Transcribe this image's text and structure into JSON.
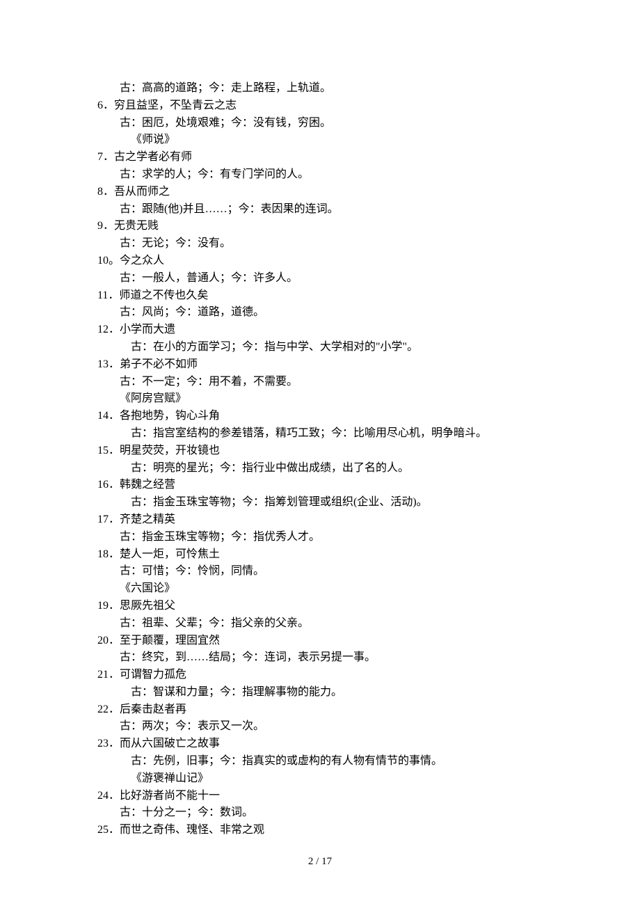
{
  "lines": [
    {
      "indent": 1,
      "text": "古：高高的道路；今：走上路程，上轨道。"
    },
    {
      "indent": 0,
      "text": "6．穷且益坚，不坠青云之志"
    },
    {
      "indent": 1,
      "text": "古：困厄，处境艰难；今：没有钱，穷困。"
    },
    {
      "indent": 2,
      "text": "《师说》"
    },
    {
      "indent": 0,
      "text": "7．古之学者必有师"
    },
    {
      "indent": 1,
      "text": "古：求学的人；今：有专门学问的人。"
    },
    {
      "indent": 0,
      "text": "8．吾从而师之"
    },
    {
      "indent": 1,
      "text": "古：跟随(他)并且……；今：表因果的连词。"
    },
    {
      "indent": 0,
      "text": "9．无贵无贱"
    },
    {
      "indent": 1,
      "text": "古：无论；今：没有。"
    },
    {
      "indent": 0,
      "text": "10。今之众人"
    },
    {
      "indent": 1,
      "text": "古：一般人，普通人；今：许多人。"
    },
    {
      "indent": 0,
      "text": "11．师道之不传也久矣"
    },
    {
      "indent": 1,
      "text": "古：风尚；今：道路，道德。"
    },
    {
      "indent": 0,
      "text": "12．小学而大遗"
    },
    {
      "indent": 2,
      "text": "古：在小的方面学习；今：指与中学、大学相对的\"小学\"。"
    },
    {
      "indent": 0,
      "text": "13．弟子不必不如师"
    },
    {
      "indent": 1,
      "text": "古：不一定；今：用不着，不需要。"
    },
    {
      "indent": 1,
      "text": "《阿房宫赋》"
    },
    {
      "indent": 0,
      "text": "14．各抱地势，钩心斗角"
    },
    {
      "indent": 2,
      "text": "古：指宫室结构的参差错落，精巧工致；今：比喻用尽心机，明争暗斗。"
    },
    {
      "indent": 0,
      "text": "15．明星荧荧，开妆镜也"
    },
    {
      "indent": 2,
      "text": "古：明亮的星光；今：指行业中做出成绩，出了名的人。"
    },
    {
      "indent": 0,
      "text": "16．韩魏之经营"
    },
    {
      "indent": 2,
      "text": "古：指金玉珠宝等物；今：指筹划管理或组织(企业、活动)。"
    },
    {
      "indent": 0,
      "text": "17．齐楚之精英"
    },
    {
      "indent": 1,
      "text": "古：指金玉珠宝等物；今：指优秀人才。"
    },
    {
      "indent": 0,
      "text": "18．楚人一炬，可怜焦土"
    },
    {
      "indent": 1,
      "text": "古：可惜；今：怜悯，同情。"
    },
    {
      "indent": 1,
      "text": "《六国论》"
    },
    {
      "indent": 0,
      "text": "19．思厥先祖父"
    },
    {
      "indent": 1,
      "text": "古：祖辈、父辈；今：指父亲的父亲。"
    },
    {
      "indent": 0,
      "text": "20．至于颠覆，理固宜然"
    },
    {
      "indent": 1,
      "text": "古：终究，到……结局；今：连词，表示另提一事。"
    },
    {
      "indent": 0,
      "text": "21．可谓智力孤危"
    },
    {
      "indent": 2,
      "text": "古：智谋和力量；今：指理解事物的能力。"
    },
    {
      "indent": 0,
      "text": "22．后秦击赵者再"
    },
    {
      "indent": 1,
      "text": "古：两次；今：表示又一次。"
    },
    {
      "indent": 0,
      "text": "23．而从六国破亡之故事"
    },
    {
      "indent": 2,
      "text": "古：先例，旧事；今：指真实的或虚构的有人物有情节的事情。"
    },
    {
      "indent": 2,
      "text": "《游褒禅山记》"
    },
    {
      "indent": 0,
      "text": "24．比好游者尚不能十一"
    },
    {
      "indent": 1,
      "text": "古：十分之一；今：数词。"
    },
    {
      "indent": 0,
      "text": "25．而世之奇伟、瑰怪、非常之观"
    }
  ],
  "footer": "2 / 17"
}
